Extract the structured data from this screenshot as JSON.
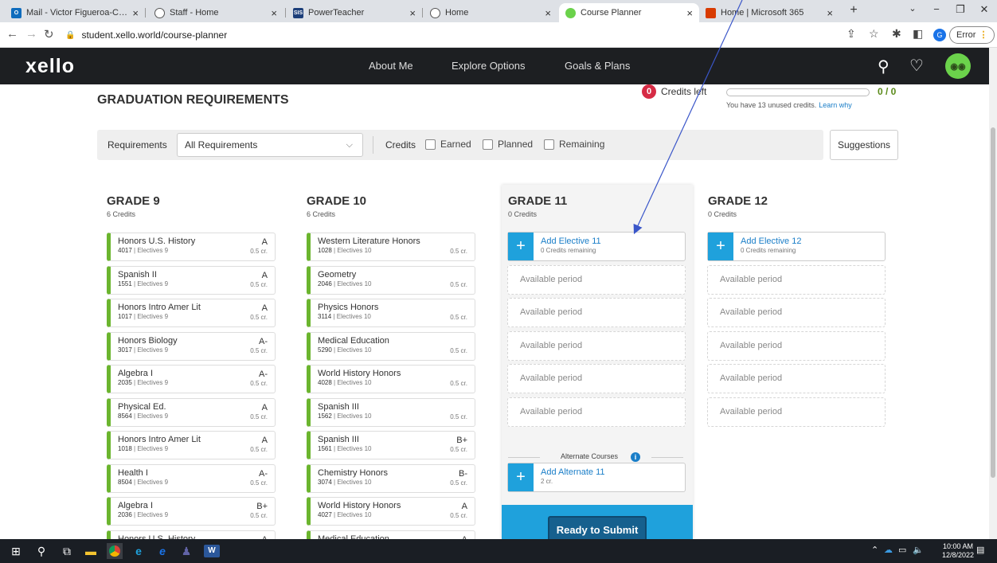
{
  "browser": {
    "tabs": [
      {
        "label": "Mail - Victor Figueroa-Cook -",
        "icon": "outlook-icon",
        "color": "#0f6cbd"
      },
      {
        "label": "Staff - Home",
        "icon": "globe-icon",
        "color": "#555555"
      },
      {
        "label": "PowerTeacher",
        "icon": "sis-icon",
        "color": "#1d3f7a"
      },
      {
        "label": "Home",
        "icon": "globe-icon",
        "color": "#555555"
      },
      {
        "label": "Course Planner",
        "icon": "xello-icon",
        "color": "#6bd24b"
      },
      {
        "label": "Home | Microsoft 365",
        "icon": "m365-icon",
        "color": "#d83b01"
      }
    ],
    "url": "student.xello.world/course-planner",
    "profile_letter": "G",
    "error_label": "Error"
  },
  "app": {
    "logo": "xello",
    "nav": [
      "About Me",
      "Explore Options",
      "Goals & Plans"
    ]
  },
  "page": {
    "title": "GRADUATION REQUIREMENTS",
    "credits_left_count": "0",
    "credits_left_label": "Credits left",
    "credit_progress": "0 / 0",
    "unused_text": "You have 13 unused credits.",
    "learn_why": "Learn why",
    "filter": {
      "requirements_label": "Requirements",
      "requirements_value": "All Requirements",
      "credits_label": "Credits",
      "earned": "Earned",
      "planned": "Planned",
      "remaining": "Remaining"
    },
    "suggestions": "Suggestions"
  },
  "grades": [
    {
      "title": "GRADE 9",
      "credits": "6 Credits",
      "courses": [
        {
          "name": "Honors U.S. History",
          "code": "4017",
          "category": "Electives 9",
          "grade": "A",
          "credit": "0.5 cr."
        },
        {
          "name": "Spanish II",
          "code": "1551",
          "category": "Electives 9",
          "grade": "A",
          "credit": "0.5 cr."
        },
        {
          "name": "Honors Intro Amer Lit",
          "code": "1017",
          "category": "Electives 9",
          "grade": "A",
          "credit": "0.5 cr."
        },
        {
          "name": "Honors Biology",
          "code": "3017",
          "category": "Electives 9",
          "grade": "A-",
          "credit": "0.5 cr."
        },
        {
          "name": "Algebra I",
          "code": "2035",
          "category": "Electives 9",
          "grade": "A-",
          "credit": "0.5 cr."
        },
        {
          "name": "Physical Ed.",
          "code": "8564",
          "category": "Electives 9",
          "grade": "A",
          "credit": "0.5 cr."
        },
        {
          "name": "Honors Intro Amer Lit",
          "code": "1018",
          "category": "Electives 9",
          "grade": "A",
          "credit": "0.5 cr."
        },
        {
          "name": "Health I",
          "code": "8504",
          "category": "Electives 9",
          "grade": "A-",
          "credit": "0.5 cr."
        },
        {
          "name": "Algebra I",
          "code": "2036",
          "category": "Electives 9",
          "grade": "B+",
          "credit": "0.5 cr."
        },
        {
          "name": "Honors U.S. History",
          "code": "",
          "category": "",
          "grade": "A",
          "credit": ""
        }
      ]
    },
    {
      "title": "GRADE 10",
      "credits": "6 Credits",
      "courses": [
        {
          "name": "Western Literature Honors",
          "code": "1028",
          "category": "Electives 10",
          "grade": "",
          "credit": "0.5 cr."
        },
        {
          "name": "Geometry",
          "code": "2046",
          "category": "Electives 10",
          "grade": "",
          "credit": "0.5 cr."
        },
        {
          "name": "Physics Honors",
          "code": "3114",
          "category": "Electives 10",
          "grade": "",
          "credit": "0.5 cr."
        },
        {
          "name": "Medical Education",
          "code": "5290",
          "category": "Electives 10",
          "grade": "",
          "credit": "0.5 cr."
        },
        {
          "name": "World History Honors",
          "code": "4028",
          "category": "Electives 10",
          "grade": "",
          "credit": "0.5 cr."
        },
        {
          "name": "Spanish III",
          "code": "1562",
          "category": "Electives 10",
          "grade": "",
          "credit": "0.5 cr."
        },
        {
          "name": "Spanish III",
          "code": "1561",
          "category": "Electives 10",
          "grade": "B+",
          "credit": "0.5 cr."
        },
        {
          "name": "Chemistry Honors",
          "code": "3074",
          "category": "Electives 10",
          "grade": "B-",
          "credit": "0.5 cr."
        },
        {
          "name": "World History Honors",
          "code": "4027",
          "category": "Electives 10",
          "grade": "A",
          "credit": "0.5 cr."
        },
        {
          "name": "Medical Education",
          "code": "",
          "category": "",
          "grade": "A",
          "credit": ""
        }
      ]
    },
    {
      "title": "GRADE 11",
      "credits": "0 Credits",
      "add_title": "Add Elective 11",
      "add_sub": "0 Credits remaining",
      "available": [
        "Available period",
        "Available period",
        "Available period",
        "Available period",
        "Available period"
      ],
      "alternate_label": "Alternate Courses",
      "alt_title": "Add Alternate 11",
      "alt_sub": "2 cr.",
      "submit": "Ready to Submit"
    },
    {
      "title": "GRADE 12",
      "credits": "0 Credits",
      "add_title": "Add Elective 12",
      "add_sub": "0 Credits remaining",
      "available": [
        "Available period",
        "Available period",
        "Available period",
        "Available period",
        "Available period"
      ]
    }
  ],
  "taskbar": {
    "time": "10:00 AM",
    "date": "12/8/2022"
  },
  "colors": {
    "accent_blue": "#1fa1dc",
    "course_green": "#6bb52e",
    "header_dark": "#1d1f22",
    "badge_red": "#d62b45"
  }
}
